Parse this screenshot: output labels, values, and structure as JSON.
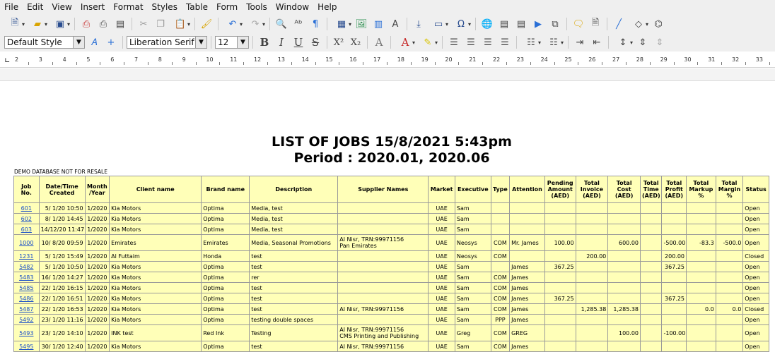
{
  "menu": [
    "File",
    "Edit",
    "View",
    "Insert",
    "Format",
    "Styles",
    "Table",
    "Form",
    "Tools",
    "Window",
    "Help"
  ],
  "toolbar2": {
    "paragraph_style": "Default Style",
    "font_name": "Liberation Serif",
    "font_size": "12"
  },
  "ruler": {
    "ticks": [
      "2",
      "3",
      "4",
      "5",
      "6",
      "7",
      "8",
      "9",
      "10",
      "11",
      "12",
      "13",
      "14",
      "15",
      "16",
      "17",
      "18",
      "19",
      "20",
      "21",
      "22",
      "23",
      "24",
      "25",
      "26",
      "27",
      "28",
      "29",
      "30",
      "31",
      "32",
      "33"
    ]
  },
  "report": {
    "title_line1": "LIST OF JOBS 15/8/2021 5:43pm",
    "title_line2": "Period : 2020.01, 2020.06",
    "demo_note": "DEMO DATABASE NOT FOR RESALE",
    "columns": [
      "Job No.",
      "Date/Time Created",
      "Month /Year",
      "Client name",
      "Brand name",
      "Description",
      "Supplier Names",
      "Market",
      "Executive",
      "Type",
      "Attention",
      "Pending Amount (AED)",
      "Total Invoice (AED)",
      "Total Cost (AED)",
      "Total Time (AED)",
      "Total Profit (AED)",
      "Total Markup %",
      "Total Margin %",
      "Status"
    ],
    "rows": [
      [
        "601",
        "5/ 1/20 10:50",
        "1/2020",
        "Kia Motors",
        "Optima",
        "Media, test",
        "",
        "UAE",
        "Sam",
        "",
        "",
        "",
        "",
        "",
        "",
        "",
        "",
        "",
        "Open"
      ],
      [
        "602",
        "8/ 1/20 14:45",
        "1/2020",
        "Kia Motors",
        "Optima",
        "Media, test",
        "",
        "UAE",
        "Sam",
        "",
        "",
        "",
        "",
        "",
        "",
        "",
        "",
        "",
        "Open"
      ],
      [
        "603",
        "14/12/20 11:47",
        "1/2020",
        "Kia Motors",
        "Optima",
        "Media, test",
        "",
        "UAE",
        "Sam",
        "",
        "",
        "",
        "",
        "",
        "",
        "",
        "",
        "",
        "Open"
      ],
      [
        "1000",
        "10/ 8/20 09:59",
        "1/2020",
        "Emirates",
        "Emirates",
        "Media, Seasonal Promotions",
        "Al Nisr, TRN:99971156\nPan Emirates",
        "UAE",
        "Neosys",
        "COM",
        "Mr. James",
        "100.00",
        "",
        "600.00",
        "",
        "-500.00",
        "-83.3",
        "-500.0",
        "Open"
      ],
      [
        "1231",
        "5/ 1/20 15:49",
        "1/2020",
        "Al Futtaim",
        "Honda",
        "test",
        "",
        "UAE",
        "Neosys",
        "COM",
        "",
        "",
        "200.00",
        "",
        "",
        "200.00",
        "",
        "",
        "Closed"
      ],
      [
        "5482",
        "5/ 1/20 10:50",
        "1/2020",
        "Kia Motors",
        "Optima",
        "test",
        "",
        "UAE",
        "Sam",
        "",
        "James",
        "367.25",
        "",
        "",
        "",
        "367.25",
        "",
        "",
        "Open"
      ],
      [
        "5483",
        "16/ 1/20 14:27",
        "1/2020",
        "Kia Motors",
        "Optima",
        "rer",
        "",
        "UAE",
        "Sam",
        "COM",
        "James",
        "",
        "",
        "",
        "",
        "",
        "",
        "",
        "Open"
      ],
      [
        "5485",
        "22/ 1/20 16:15",
        "1/2020",
        "Kia Motors",
        "Optima",
        "test",
        "",
        "UAE",
        "Sam",
        "COM",
        "James",
        "",
        "",
        "",
        "",
        "",
        "",
        "",
        "Open"
      ],
      [
        "5486",
        "22/ 1/20 16:51",
        "1/2020",
        "Kia Motors",
        "Optima",
        "test",
        "",
        "UAE",
        "Sam",
        "COM",
        "James",
        "367.25",
        "",
        "",
        "",
        "367.25",
        "",
        "",
        "Open"
      ],
      [
        "5487",
        "22/ 1/20 16:53",
        "1/2020",
        "Kia Motors",
        "Optima",
        "test",
        "Al Nisr, TRN:99971156",
        "UAE",
        "Sam",
        "COM",
        "James",
        "",
        "1,285.38",
        "1,285.38",
        "",
        "",
        "0.0",
        "0.0",
        "Closed"
      ],
      [
        "5492",
        "23/ 1/20 11:16",
        "1/2020",
        "Kia Motors",
        "Optima",
        "testing double spaces",
        "",
        "UAE",
        "Sam",
        "PPP",
        "James",
        "",
        "",
        "",
        "",
        "",
        "",
        "",
        "Open"
      ],
      [
        "5493",
        "23/ 1/20 14:10",
        "1/2020",
        "INK test",
        "Red Ink",
        "Testing",
        "Al Nisr, TRN:99971156\nCMS Printing and Publishing",
        "UAE",
        "Greg",
        "COM",
        "GREG",
        "",
        "",
        "100.00",
        "",
        "-100.00",
        "",
        "",
        "Open"
      ],
      [
        "5495",
        "30/ 1/20 12:40",
        "1/2020",
        "Kia Motors",
        "Optima",
        "test",
        "Al Nisr, TRN:99971156",
        "UAE",
        "Sam",
        "COM",
        "James",
        "",
        "",
        "",
        "",
        "",
        "",
        "",
        "Open"
      ]
    ]
  }
}
